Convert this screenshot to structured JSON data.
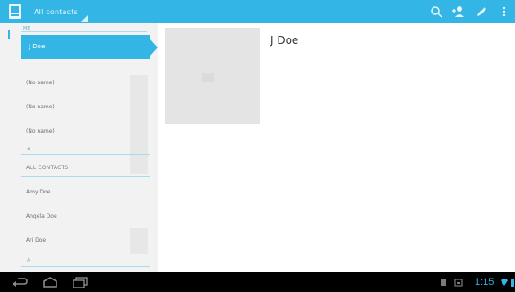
{
  "action_bar": {
    "account_label": "All contacts",
    "background": "#33b5e5",
    "actions": [
      "search-icon",
      "add-contact-icon",
      "edit-icon",
      "overflow-icon"
    ]
  },
  "contact_list": {
    "section_letter": "ME",
    "selected_item": "J Doe",
    "unnamed_items": [
      "(No name)",
      "(No name)",
      "(No name)"
    ],
    "section_marker_1": "#",
    "section_header": "ALL CONTACTS",
    "items": [
      "Amy Doe",
      "Angela Doe",
      "Ari Doe"
    ],
    "section_marker_2": "A"
  },
  "detail": {
    "name": "J Doe"
  },
  "navigation_bar": {
    "buttons": [
      "back-icon",
      "home-icon",
      "recent-apps-icon"
    ],
    "time": "1:15",
    "accent": "#33b5e5"
  }
}
